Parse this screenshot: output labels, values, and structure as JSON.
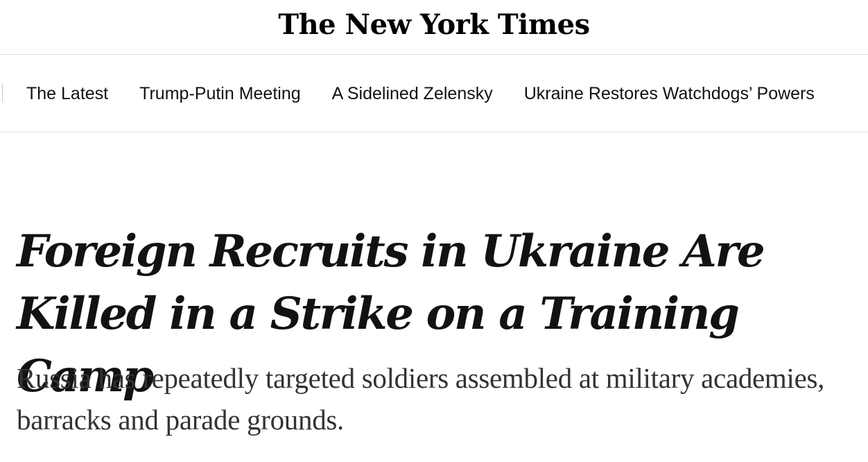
{
  "masthead": {
    "logo_text": "The New York Times"
  },
  "nav": {
    "items": [
      {
        "label": "The Latest"
      },
      {
        "label": "Trump-Putin Meeting"
      },
      {
        "label": "A Sidelined Zelensky"
      },
      {
        "label": "Ukraine Restores Watchdogs’ Powers"
      }
    ]
  },
  "article": {
    "headline": "Foreign Recruits in Ukraine Are Killed in a Strike on a Training Camp",
    "summary": "Russia has repeatedly targeted soldiers assembled at military academies, barracks and parade grounds."
  }
}
